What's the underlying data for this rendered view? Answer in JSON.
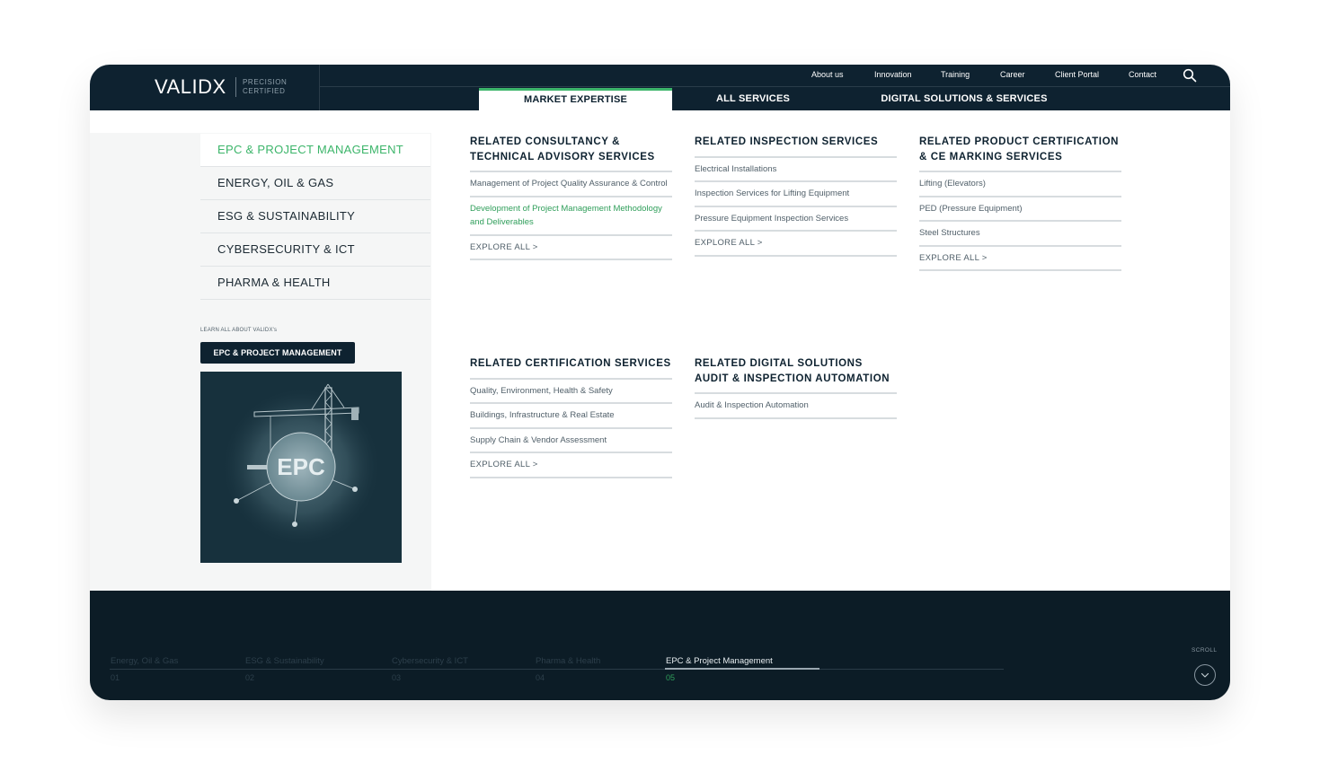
{
  "header": {
    "logo": "VALIDX",
    "tagline_line1": "PRECISION",
    "tagline_line2": "CERTIFIED",
    "top_links": [
      "About us",
      "Innovation",
      "Training",
      "Career",
      "Client Portal",
      "Contact"
    ],
    "tabs": [
      {
        "label": "MARKET EXPERTISE",
        "active": true
      },
      {
        "label": "ALL SERVICES",
        "active": false
      },
      {
        "label": "DIGITAL SOLUTIONS & SERVICES",
        "active": false
      }
    ]
  },
  "sidebar": {
    "items": [
      {
        "label": "EPC & PROJECT MANAGEMENT",
        "active": true
      },
      {
        "label": "ENERGY, OIL & GAS",
        "active": false
      },
      {
        "label": "ESG & SUSTAINABILITY",
        "active": false
      },
      {
        "label": "CYBERSECURITY & ICT",
        "active": false
      },
      {
        "label": "PHARMA & HEALTH",
        "active": false
      }
    ],
    "learn_label": "LEARN ALL ABOUT VALIDX's",
    "learn_button": "EPC & PROJECT MANAGEMENT",
    "image_text": "EPC"
  },
  "columns": [
    {
      "title": "RELATED CONSULTANCY & TECHNICAL ADVISORY SERVICES",
      "links": [
        "Management of Project Quality Assurance & Control",
        "Development of Project Management Methodology and Deliverables"
      ],
      "highlight_index": 1,
      "explore": "EXPLORE ALL >"
    },
    {
      "title": "RELATED INSPECTION SERVICES",
      "links": [
        "Electrical Installations",
        "Inspection Services for Lifting Equipment",
        "Pressure Equipment Inspection Services"
      ],
      "explore": "EXPLORE ALL >"
    },
    {
      "title": "RELATED PRODUCT CERTIFICATION & CE MARKING SERVICES",
      "links": [
        "Lifting (Elevators)",
        "PED (Pressure Equipment)",
        "Steel Structures"
      ],
      "explore": "EXPLORE ALL >"
    },
    {
      "title": "RELATED CERTIFICATION SERVICES",
      "links": [
        "Quality, Environment, Health & Safety",
        "Buildings, Infrastructure & Real Estate",
        "Supply Chain & Vendor Assessment"
      ],
      "explore": "EXPLORE ALL >"
    },
    {
      "title": "RELATED DIGITAL SOLUTIONS AUDIT & INSPECTION AUTOMATION",
      "links": [
        "Audit & Inspection Automation"
      ]
    }
  ],
  "bottom": {
    "slides": [
      {
        "label": "Energy, Oil & Gas",
        "num": "01"
      },
      {
        "label": "ESG & Sustainability",
        "num": "02"
      },
      {
        "label": "Cybersecurity & ICT",
        "num": "03"
      },
      {
        "label": "Pharma & Health",
        "num": "04"
      },
      {
        "label": "EPC & Project Management",
        "num": "05",
        "active": true
      }
    ],
    "scroll_label": "SCROLL"
  },
  "colors": {
    "navy": "#0e2230",
    "accent_green": "#3cb56a",
    "footer": "#0c1c26"
  }
}
